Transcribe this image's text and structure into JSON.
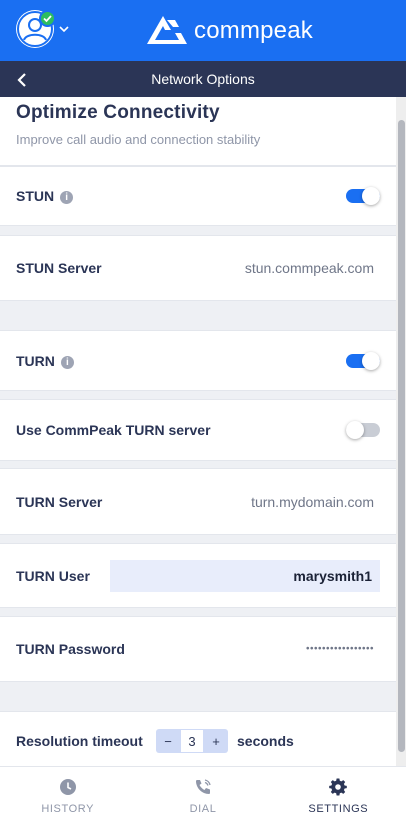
{
  "brand": {
    "name": "commpeak",
    "header_color": "#1a6ff2",
    "subbar_color": "#2b3556"
  },
  "header": {
    "avatar_icon": "user-avatar-icon",
    "status": "online",
    "menu_icon": "chevron-down-icon"
  },
  "subbar": {
    "title": "Network Options",
    "back_icon": "chevron-left-icon"
  },
  "section": {
    "title": "Optimize Connectivity",
    "subtitle": "Improve call audio and connection stability"
  },
  "rows": {
    "stun": {
      "label": "STUN",
      "enabled": true
    },
    "stun_server": {
      "label": "STUN Server",
      "value": "stun.commpeak.com"
    },
    "turn": {
      "label": "TURN",
      "enabled": true
    },
    "use_commpeak_turn": {
      "label": "Use CommPeak TURN server",
      "enabled": false
    },
    "turn_server": {
      "label": "TURN Server",
      "value": "turn.mydomain.com"
    },
    "turn_user": {
      "label": "TURN User",
      "value": "marysmith1"
    },
    "turn_password": {
      "label": "TURN Password",
      "masked": "•••••••••••••••••"
    },
    "resolution_timeout": {
      "label": "Resolution timeout",
      "value": "3",
      "minus": "−",
      "plus": "+",
      "unit": "seconds"
    }
  },
  "tabs": [
    {
      "label": "HISTORY",
      "icon": "clock-icon",
      "active": false
    },
    {
      "label": "DIAL",
      "icon": "phone-icon",
      "active": false
    },
    {
      "label": "SETTINGS",
      "icon": "gear-icon",
      "active": true
    }
  ]
}
